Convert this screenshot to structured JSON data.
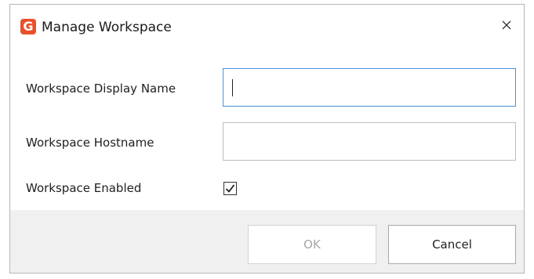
{
  "window": {
    "title": "Manage Workspace",
    "app_icon_glyph": "G",
    "app_icon_color": "#e8502a"
  },
  "form": {
    "display_name": {
      "label": "Workspace Display Name",
      "value": ""
    },
    "hostname": {
      "label": "Workspace Hostname",
      "value": ""
    },
    "enabled": {
      "label": "Workspace Enabled",
      "checked": true
    }
  },
  "buttons": {
    "ok_label": "OK",
    "ok_disabled": true,
    "cancel_label": "Cancel"
  },
  "icons": {
    "close": "close-icon",
    "checkmark": "checkmark-icon",
    "app": "app-icon"
  },
  "colors": {
    "focus_border": "#4a90d9",
    "footer_bg": "#f0f0f0",
    "disabled_text": "#a7a7a7"
  }
}
